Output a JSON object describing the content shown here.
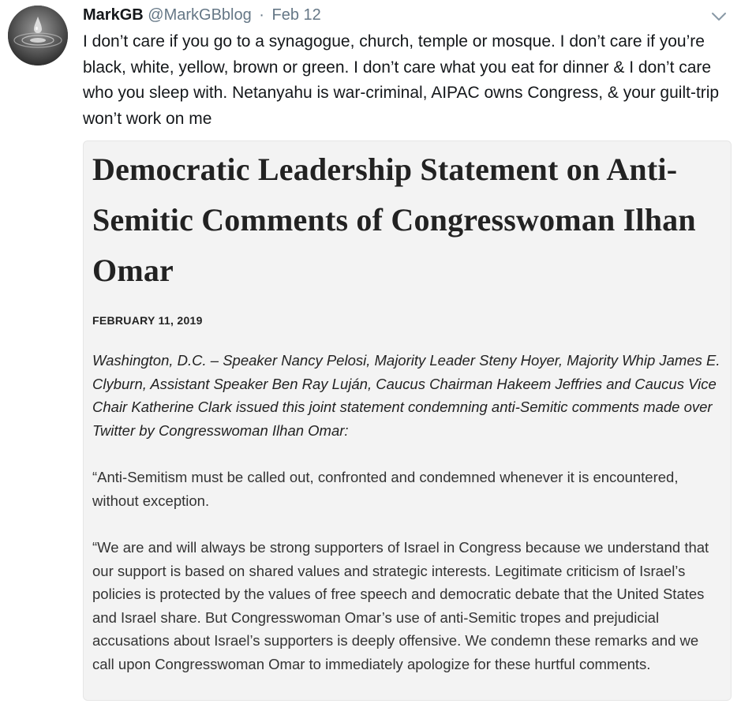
{
  "tweet": {
    "avatar_icon": "water-drop-avatar",
    "display_name": "MarkGB",
    "handle": "@MarkGBblog",
    "separator": "·",
    "date": "Feb 12",
    "menu_icon": "chevron-down-icon",
    "text": "I don’t care if you go to a synagogue, church, temple or mosque. I don’t care if you’re black, white, yellow, brown or green. I don’t care what you eat for dinner & I don’t care who you sleep with. Netanyahu is war-criminal, AIPAC owns Congress, & your guilt-trip won’t work on me"
  },
  "card": {
    "title": "Democratic Leadership Statement on Anti-Semitic Comments of Congresswoman Ilhan Omar",
    "date": "FEBRUARY 11, 2019",
    "intro": "Washington, D.C. – Speaker Nancy Pelosi, Majority Leader Steny Hoyer, Majority Whip James E. Clyburn, Assistant Speaker Ben Ray Luján, Caucus Chairman Hakeem Jeffries and Caucus Vice Chair Katherine Clark issued this joint statement condemning anti-Semitic comments made over Twitter by Congresswoman Ilhan Omar:",
    "paragraph_1": "“Anti-Semitism must be called out, confronted and condemned whenever it is encountered, without exception.",
    "paragraph_2": "“We are and will always be strong supporters of Israel in Congress because we understand that our support is based on shared values and strategic interests. Legitimate criticism of Israel’s policies is protected by the values of free speech and democratic debate that the United States and Israel share.  But Congresswoman Omar’s use of anti-Semitic tropes and prejudicial accusations about Israel’s supporters is deeply offensive.  We condemn these remarks and we call upon Congresswoman Omar to immediately apologize for these hurtful comments."
  },
  "colors": {
    "text_primary": "#14171a",
    "text_secondary": "#657786",
    "card_background": "#f3f3f3"
  }
}
